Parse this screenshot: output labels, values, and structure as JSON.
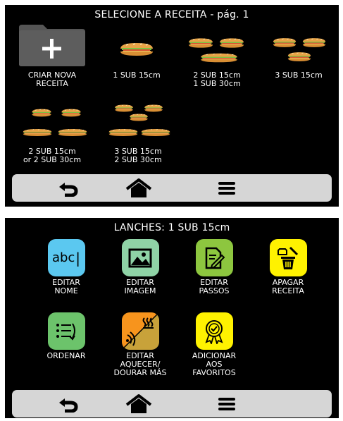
{
  "recipe_select": {
    "title": "SELECIONE A RECEITA - pág. 1",
    "tiles": [
      {
        "label": "CRIAR NOVA\nRECEITA",
        "icon": "add-folder-icon"
      },
      {
        "label": "1 SUB 15cm",
        "icon": "sandwich-icon"
      },
      {
        "label": "2 SUB 15cm\n1 SUB 30cm",
        "icon": "sandwich-icon"
      },
      {
        "label": "3 SUB 15cm",
        "icon": "sandwich-icon"
      },
      {
        "label": "2 SUB 15cm\nor 2 SUB 30cm",
        "icon": "sandwich-icon"
      },
      {
        "label": "3 SUB 15cm\n2 SUB 30cm",
        "icon": "sandwich-icon"
      }
    ]
  },
  "recipe_menu": {
    "title": "LANCHES: 1 SUB 15cm",
    "actions": [
      {
        "label": "EDITAR\nNOME",
        "icon": "text-edit-icon",
        "color": "#5bc8f0",
        "icon_text": "abc"
      },
      {
        "label": "EDITAR\nIMAGEM",
        "icon": "image-icon",
        "color": "#8fd3a6"
      },
      {
        "label": "EDITAR\nPASSOS",
        "icon": "edit-steps-icon",
        "color": "#8dc63f"
      },
      {
        "label": "APAGAR\nRECEITA",
        "icon": "trash-icon",
        "color": "#fff200"
      },
      {
        "label": "ORDENAR",
        "icon": "sort-list-icon",
        "color": "#6cc36b"
      },
      {
        "label": "EDITAR\nAQUECER/\nDOURAR MÁS",
        "icon": "heat-browning-icon",
        "color": "#f7941d"
      },
      {
        "label": "ADICIONAR\nAOS\nFAVORITOS",
        "icon": "favorite-award-icon",
        "color": "#fff200"
      }
    ]
  },
  "navbar": {
    "back_icon": "back-arrow-icon",
    "home_icon": "home-icon",
    "menu_icon": "menu-icon"
  }
}
